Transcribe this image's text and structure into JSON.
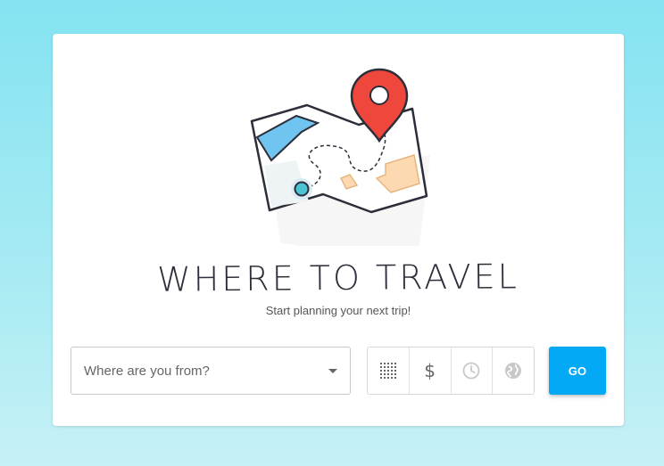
{
  "hero": {
    "title": "WHERE TO TRAVEL",
    "subtitle": "Start planning your next trip!",
    "illustration_icon": "map-pin-icon"
  },
  "search": {
    "origin_select_value": "Where are you from?",
    "filters": [
      {
        "icon": "grid-icon",
        "state": "active"
      },
      {
        "icon": "dollar-icon",
        "label": "$",
        "state": "active"
      },
      {
        "icon": "clock-icon",
        "state": "disabled"
      },
      {
        "icon": "globe-icon",
        "state": "disabled"
      }
    ],
    "go_label": "GO"
  },
  "colors": {
    "accent": "#03a9f4",
    "pin": "#f0473c",
    "background_top": "#84e3f1",
    "map_blue": "#6fc4f0",
    "map_peach": "#fcd9b0"
  }
}
